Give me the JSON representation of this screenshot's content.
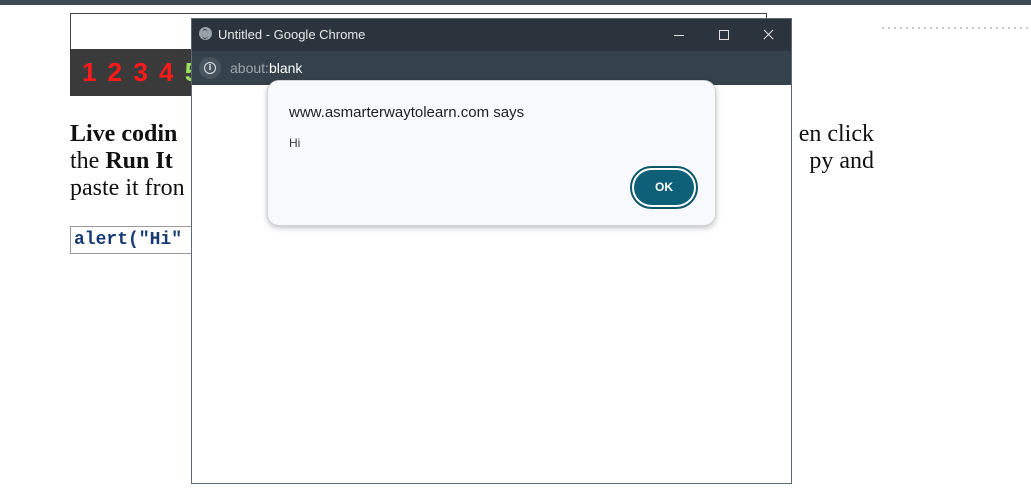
{
  "background_page": {
    "number_strip": "1 2 3 4",
    "number_strip_last": "5",
    "paragraph": {
      "line1_left": "Live codin",
      "line1_right": "en click",
      "line2_left_plain": "the ",
      "line2_left_bold": "Run It",
      "line2_right": "py and",
      "line3_left": "paste it fron"
    },
    "code_field_value": "alert(\"Hi\""
  },
  "chrome_window": {
    "title": "Untitled - Google Chrome",
    "url_scheme": "about:",
    "url_host": "blank"
  },
  "alert_dialog": {
    "title": "www.asmarterwaytolearn.com says",
    "message": "Hi",
    "ok_label": "OK"
  },
  "colors": {
    "titlebar": "#2b343c",
    "addressbar": "#36424b",
    "ok_button": "#0e5f78",
    "number_strip": "#ff1a1a"
  }
}
